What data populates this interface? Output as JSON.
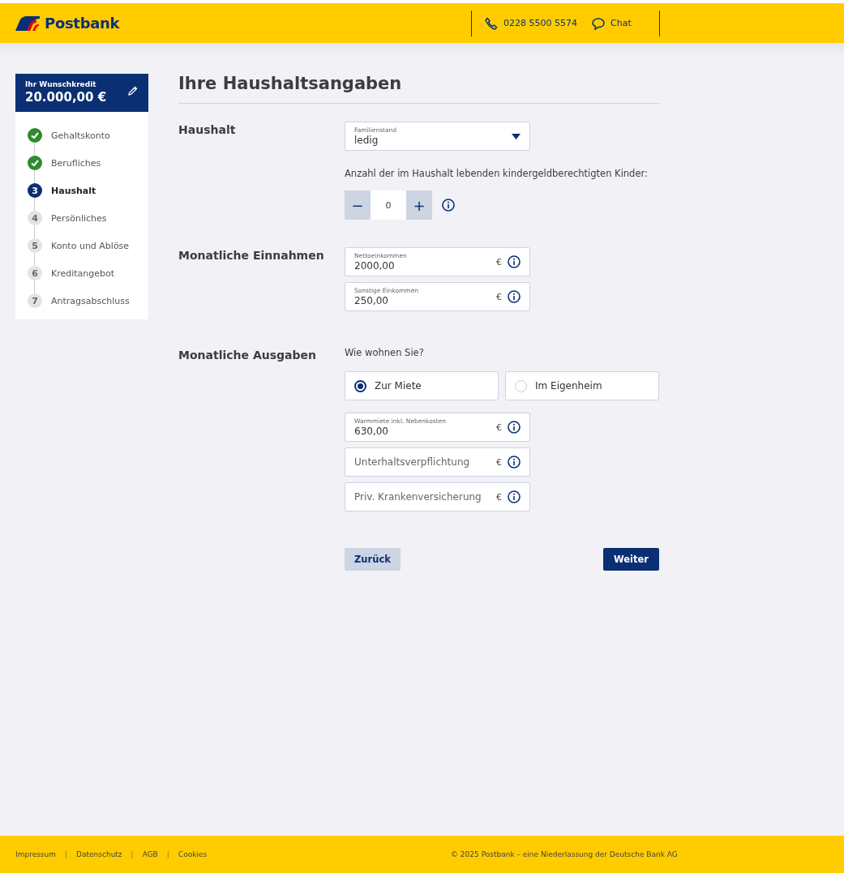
{
  "header": {
    "brand": "Postbank",
    "phone": "0228 5500 5574",
    "chat": "Chat"
  },
  "sidebar": {
    "summary_label": "Ihr Wunschkredit",
    "summary_amount": "20.000,00 €",
    "steps": [
      {
        "label": "Gehaltskonto",
        "done": true,
        "selected": false
      },
      {
        "label": "Berufliches",
        "done": true,
        "selected": false
      },
      {
        "number": "3",
        "label": "Haushalt",
        "done": false,
        "selected": true
      },
      {
        "number": "4",
        "label": "Persönliches",
        "done": false,
        "selected": false
      },
      {
        "number": "5",
        "label": "Konto und Ablöse",
        "done": false,
        "selected": false
      },
      {
        "number": "6",
        "label": "Kreditangebot",
        "done": false,
        "selected": false
      },
      {
        "number": "7",
        "label": "Antragsabschluss",
        "done": false,
        "selected": false
      }
    ]
  },
  "title": "Ihre Haushaltsangaben",
  "sections": [
    {
      "heading": "Haushalt",
      "items": [
        {
          "kind": "select",
          "label": "Familienstand",
          "value": "ledig"
        },
        {
          "kind": "text",
          "text": "Anzahl der im Haushalt lebenden kindergeldberechtigten Kinder:"
        },
        {
          "kind": "stepper",
          "minus": "−",
          "value": "0",
          "plus": "+"
        }
      ]
    },
    {
      "heading": "Monatliche Einnahmen",
      "items": [
        {
          "kind": "money",
          "label": "Nettoeinkommen",
          "value": "2000,00",
          "unit": "€"
        },
        {
          "kind": "money",
          "label": "Sonstige Einkommen",
          "value": "250,00",
          "unit": "€"
        }
      ]
    },
    {
      "heading": "Monatliche Ausgaben",
      "items": [
        {
          "kind": "text",
          "text": "Wie wohnen Sie?"
        },
        {
          "kind": "radios",
          "options": [
            {
              "label": "Zur Miete",
              "selected": true
            },
            {
              "label": "Im Eigenheim",
              "selected": false
            }
          ]
        },
        {
          "kind": "money",
          "label": "Warmmiete inkl. Nebenkosten",
          "value": "630,00",
          "unit": "€"
        },
        {
          "kind": "money",
          "placeholder": "Unterhaltsverpflichtung",
          "unit": "€"
        },
        {
          "kind": "money",
          "placeholder": "Priv. Krankenversicherung",
          "unit": "€"
        }
      ]
    }
  ],
  "buttons": {
    "back": "Zurück",
    "next": "Weiter"
  },
  "footer": {
    "links": [
      {
        "kind": "link",
        "text": "Impressum"
      },
      {
        "kind": "separator",
        "text": "|"
      },
      {
        "kind": "link",
        "text": "Datenschutz"
      },
      {
        "kind": "separator",
        "text": "|"
      },
      {
        "kind": "link",
        "text": "AGB"
      },
      {
        "kind": "separator",
        "text": "|"
      },
      {
        "kind": "link",
        "text": "Cookies"
      }
    ],
    "copyright": "© 2025 Postbank – eine Niederlassung der Deutsche Bank AG"
  }
}
